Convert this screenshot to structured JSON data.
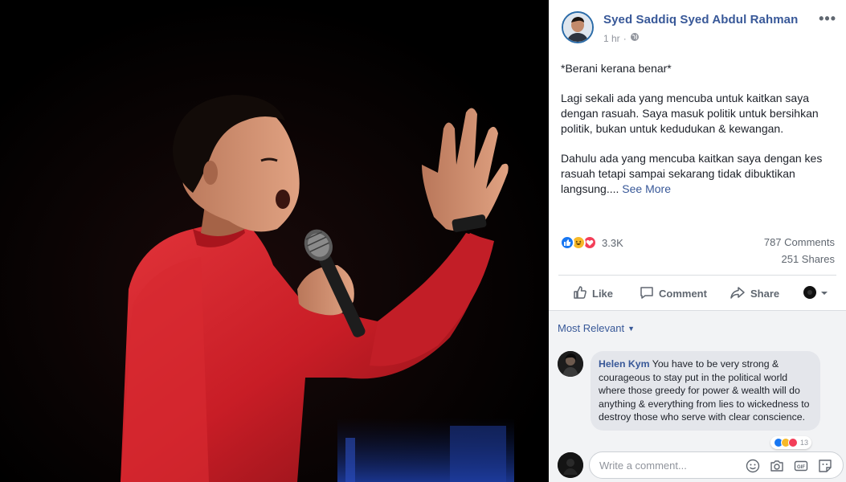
{
  "post": {
    "author": "Syed Saddiq Syed Abdul Rahman",
    "time": "1 hr",
    "paragraphs": [
      "*Berani kerana benar*",
      "Lagi sekali ada yang mencuba untuk kaitkan saya dengan rasuah. Saya masuk politik untuk bersihkan politik, bukan untuk kedudukan & kewangan.",
      "Dahulu ada yang mencuba kaitkan saya dengan kes rasuah tetapi sampai sekarang tidak dibuktikan langsung...."
    ],
    "see_more": "See More",
    "reaction_count": "3.3K",
    "comments_count": "787 Comments",
    "shares_count": "251 Shares"
  },
  "actions": {
    "like": "Like",
    "comment": "Comment",
    "share": "Share"
  },
  "comments": {
    "sort_label": "Most Relevant",
    "items": [
      {
        "name": "Helen Kym",
        "text": "You have to be very strong & courageous to stay put in the political world where those greedy for power & wealth will do anything & everything from lies to wickedness to destroy those who serve with clear conscience.",
        "reactions": "13"
      }
    ],
    "write_placeholder": "Write a comment..."
  },
  "icons": {
    "globe": "globe-icon",
    "more": "more-options-icon",
    "like": "thumbs-up-icon",
    "comment": "comment-icon",
    "share": "share-icon",
    "emoji": "emoji-icon",
    "camera": "camera-icon",
    "gif": "gif-icon",
    "sticker": "sticker-icon"
  },
  "colors": {
    "link": "#385898",
    "like": "#1877f2",
    "haha": "#f7b928",
    "love": "#f33e58"
  }
}
